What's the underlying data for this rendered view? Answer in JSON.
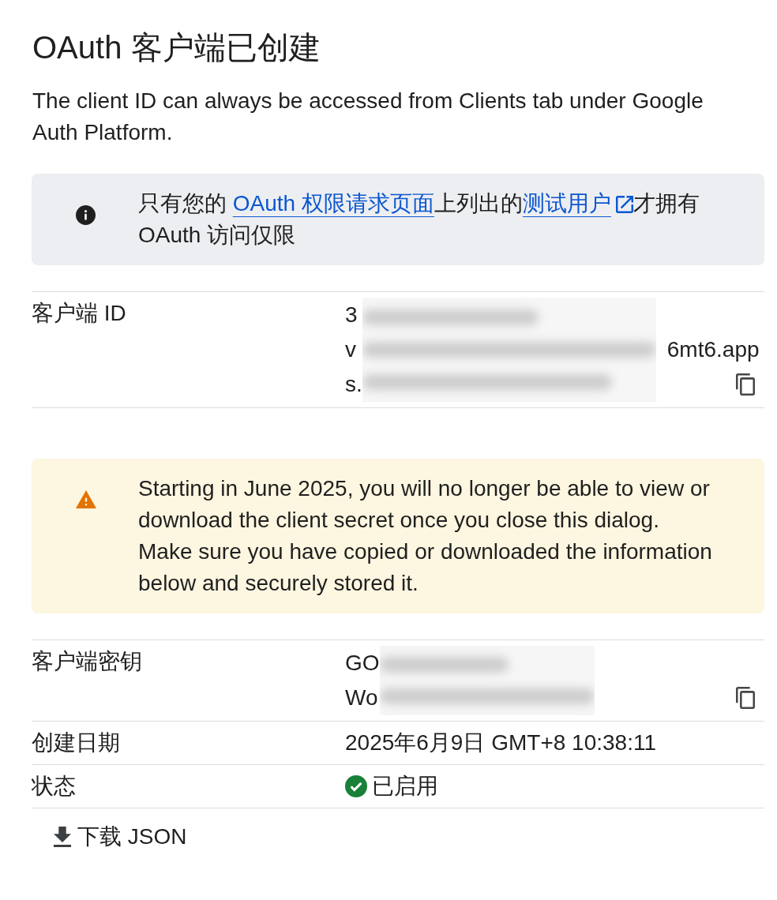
{
  "dialog": {
    "title": "OAuth 客户端已创建",
    "description": "The client ID can always be accessed from Clients tab under Google Auth Platform."
  },
  "content": [
    {
      "kind": "info",
      "parts": [
        {
          "kind": "text",
          "text": "只有您的 "
        },
        {
          "kind": "link",
          "text": "OAuth 权限请求页面",
          "external": false
        },
        {
          "kind": "text",
          "text": "上列出的"
        },
        {
          "kind": "link",
          "text": "测试用户",
          "external": true
        },
        {
          "kind": "text",
          "text": "才拥有 OAuth 访问仅限"
        }
      ]
    },
    {
      "kind": "details",
      "rows": [
        {
          "label": "客户端 ID",
          "kind": "redacted",
          "lines": [
            {
              "prefix": "3"
            },
            {
              "prefix": "v",
              "suffix": "6mt6.app"
            },
            {
              "prefix": "s."
            }
          ],
          "copy_button": true
        }
      ]
    },
    {
      "kind": "warning",
      "parts": [
        {
          "kind": "text",
          "text": "Starting in June 2025, you will no longer be able to view or download the client secret once you close this dialog. Make sure you have copied or downloaded the information below and securely stored it."
        }
      ]
    },
    {
      "kind": "details",
      "rows": [
        {
          "label": "客户端密钥",
          "kind": "redacted",
          "lines": [
            {
              "prefix": "GO"
            },
            {
              "prefix": "Wo"
            }
          ],
          "copy_button": true
        },
        {
          "label": "创建日期",
          "kind": "text",
          "value": "2025年6月9日 GMT+8 10:38:11"
        },
        {
          "label": "状态",
          "kind": "status",
          "value": "已启用",
          "enabled": true
        }
      ]
    }
  ],
  "download_button": {
    "label": "下载 JSON"
  }
}
